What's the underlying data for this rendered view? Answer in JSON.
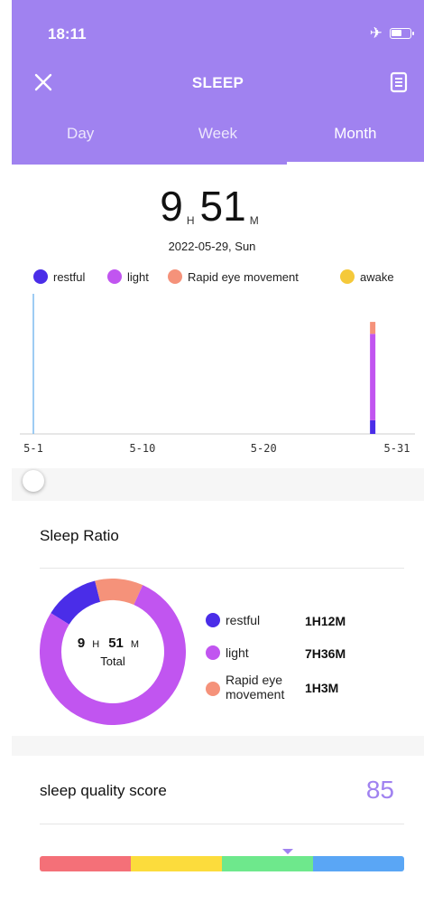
{
  "status_bar": {
    "time": "18:11"
  },
  "header": {
    "title": "SLEEP",
    "tabs": [
      {
        "label": "Day",
        "active": false
      },
      {
        "label": "Week",
        "active": false
      },
      {
        "label": "Month",
        "active": true
      }
    ]
  },
  "summary": {
    "hours": "9",
    "hours_unit": "H",
    "minutes": "51",
    "minutes_unit": "M",
    "date": "2022-05-29, Sun"
  },
  "legend": [
    {
      "label": "restful",
      "color": "#4a2de8"
    },
    {
      "label": "light",
      "color": "#c155f0"
    },
    {
      "label": "Rapid eye movement",
      "color": "#f5927a"
    },
    {
      "label": "awake",
      "color": "#f5c93a"
    }
  ],
  "chart_data": {
    "type": "bar",
    "stacked": true,
    "x_ticks": [
      "5-1",
      "5-10",
      "5-20",
      "5-31"
    ],
    "x_range": [
      1,
      31
    ],
    "bars": [
      {
        "day": 29,
        "segments": {
          "restful": 72,
          "light": 456,
          "Rapid eye movement": 63,
          "awake": 0
        }
      }
    ],
    "selected_day": 1
  },
  "sleep_ratio": {
    "title": "Sleep Ratio",
    "center_hours": "9",
    "center_hours_unit": "H",
    "center_minutes": "51",
    "center_minutes_unit": "M",
    "center_label": "Total",
    "items": [
      {
        "label": "restful",
        "value": "1H12M",
        "minutes": 72,
        "color": "#4a2de8"
      },
      {
        "label": "light",
        "value": "7H36M",
        "minutes": 456,
        "color": "#c155f0"
      },
      {
        "label": "Rapid eye movement",
        "value": "1H3M",
        "minutes": 63,
        "color": "#f5927a"
      }
    ]
  },
  "quality": {
    "label": "sleep quality score",
    "score": "85",
    "score_fraction": 0.68,
    "scale_colors": [
      "#f47078",
      "#fcdc3c",
      "#6ee88c",
      "#5aa6f5"
    ]
  }
}
